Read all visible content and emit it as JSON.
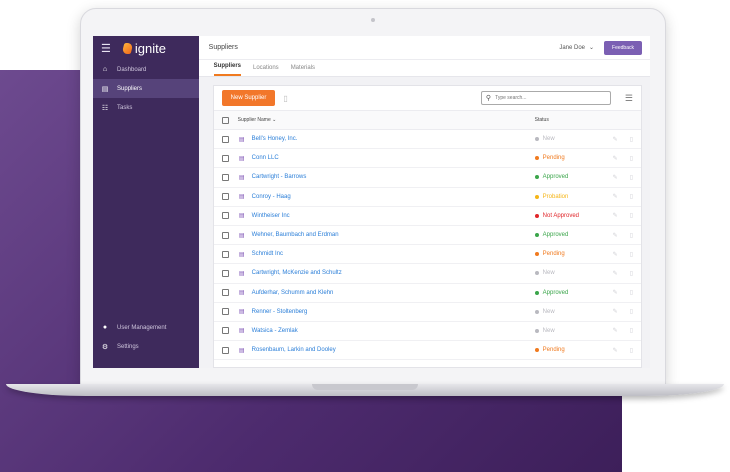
{
  "app": {
    "name": "ignite",
    "page_title": "Suppliers",
    "user": "Jane Doe",
    "feedback_label": "Feedback"
  },
  "sidebar": {
    "items": [
      {
        "label": "Dashboard",
        "icon": "home-icon",
        "active": false
      },
      {
        "label": "Suppliers",
        "icon": "factory-icon",
        "active": true
      },
      {
        "label": "Tasks",
        "icon": "tasks-icon",
        "active": false
      }
    ],
    "bottom_items": [
      {
        "label": "User Management",
        "icon": "user-icon"
      },
      {
        "label": "Settings",
        "icon": "gear-icon"
      }
    ]
  },
  "tabs": [
    {
      "label": "Suppliers",
      "active": true
    },
    {
      "label": "Locations",
      "active": false
    },
    {
      "label": "Materials",
      "active": false
    }
  ],
  "toolbar": {
    "new_button": "New Supplier",
    "search_placeholder": "Type search..."
  },
  "table": {
    "columns": [
      "Supplier Name ⌄",
      "Status"
    ],
    "rows": [
      {
        "name": "Bell's Honey, Inc.",
        "status": "New",
        "status_color": "#b9b9c0"
      },
      {
        "name": "Conn LLC",
        "status": "Pending",
        "status_color": "#f07a1f"
      },
      {
        "name": "Cartwright - Barrows",
        "status": "Approved",
        "status_color": "#3aa54a"
      },
      {
        "name": "Conroy - Haag",
        "status": "Probation",
        "status_color": "#f5b517"
      },
      {
        "name": "Wintheiser Inc",
        "status": "Not Approved",
        "status_color": "#e0262a"
      },
      {
        "name": "Wehner, Baumbach and Erdman",
        "status": "Approved",
        "status_color": "#3aa54a"
      },
      {
        "name": "Schmidt Inc",
        "status": "Pending",
        "status_color": "#f07a1f"
      },
      {
        "name": "Cartwright, McKenzie and Schultz",
        "status": "New",
        "status_color": "#b9b9c0"
      },
      {
        "name": "Aufderhar, Schumm and Klehn",
        "status": "Approved",
        "status_color": "#3aa54a"
      },
      {
        "name": "Renner - Stoltenberg",
        "status": "New",
        "status_color": "#b9b9c0"
      },
      {
        "name": "Watsica - Zemlak",
        "status": "New",
        "status_color": "#b9b9c0"
      },
      {
        "name": "Rosenbaum, Larkin and Dooley",
        "status": "Pending",
        "status_color": "#f07a1f"
      }
    ]
  }
}
